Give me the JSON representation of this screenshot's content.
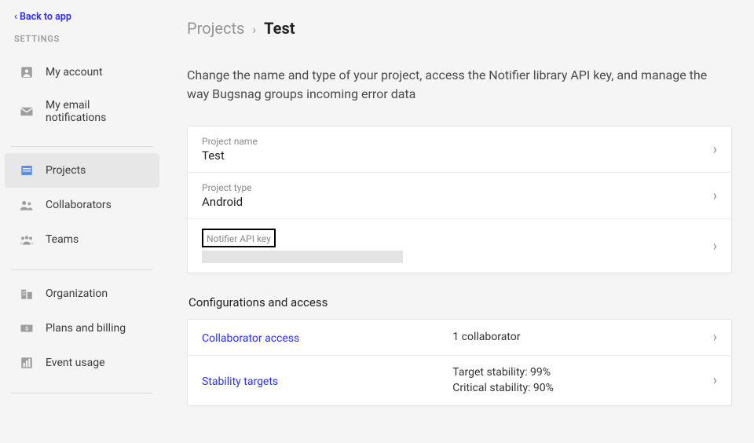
{
  "back_link": "‹  Back to app",
  "sidebar": {
    "section_label": "SETTINGS",
    "items": [
      {
        "label": "My account",
        "icon": "account"
      },
      {
        "label": "My email notifications",
        "icon": "mail"
      },
      {
        "label": "Projects",
        "icon": "projects",
        "active": true
      },
      {
        "label": "Collaborators",
        "icon": "collaborators"
      },
      {
        "label": "Teams",
        "icon": "teams"
      },
      {
        "label": "Organization",
        "icon": "organization"
      },
      {
        "label": "Plans and billing",
        "icon": "billing"
      },
      {
        "label": "Event usage",
        "icon": "usage"
      }
    ]
  },
  "breadcrumb": {
    "root": "Projects",
    "sep": "›",
    "current": "Test"
  },
  "intro": "Change the name and type of your project, access the Notifier library API key, and manage the way Bugsnag groups incoming error data",
  "rows": {
    "project_name": {
      "label": "Project name",
      "value": "Test"
    },
    "project_type": {
      "label": "Project type",
      "value": "Android"
    },
    "api_key": {
      "label": "Notifier API key",
      "value": ""
    }
  },
  "config_section_title": "Configurations and access",
  "config_rows": {
    "collab": {
      "link": "Collaborator access",
      "value": "1 collaborator"
    },
    "stability": {
      "link": "Stability targets",
      "line1": "Target stability: 99%",
      "line2": "Critical stability: 90%"
    }
  }
}
